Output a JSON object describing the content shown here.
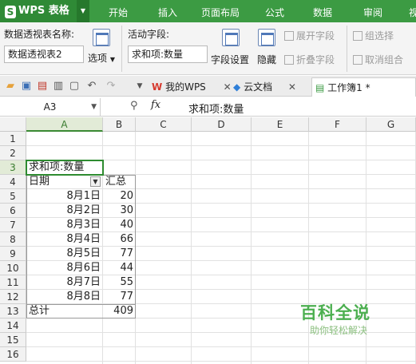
{
  "app": {
    "logo_text": "WPS 表格",
    "logo_mark": "S"
  },
  "tabs": [
    "开始",
    "插入",
    "页面布局",
    "公式",
    "数据",
    "审阅",
    "视"
  ],
  "ribbon": {
    "pivot_name_label": "数据透视表名称:",
    "pivot_name_value": "数据透视表2",
    "options_label": "选项",
    "active_field_label": "活动字段:",
    "active_field_value": "求和项:数量",
    "field_settings_label": "字段设置",
    "hide_label": "隐藏",
    "expand_field_label": "展开字段",
    "collapse_field_label": "折叠字段",
    "group_selection_label": "组选择",
    "ungroup_label": "取消组合"
  },
  "doc_tabs": [
    {
      "label": "我的WPS"
    },
    {
      "label": "云文档"
    },
    {
      "label": "工作簿1 *"
    }
  ],
  "formula_bar": {
    "name_box": "A3",
    "fx": "fx",
    "value": "求和项:数量"
  },
  "sheet": {
    "columns": [
      "A",
      "B",
      "C",
      "D",
      "E",
      "F",
      "G"
    ],
    "rows": [
      "1",
      "2",
      "3",
      "4",
      "5",
      "6",
      "7",
      "8",
      "9",
      "10",
      "11",
      "12",
      "13",
      "14",
      "15",
      "16"
    ],
    "pivot_header": "求和项:数量",
    "date_header": "日期",
    "sum_header": "汇总",
    "dates": [
      "8月1日",
      "8月2日",
      "8月3日",
      "8月4日",
      "8月5日",
      "8月6日",
      "8月7日",
      "8月8日"
    ],
    "values": [
      "20",
      "30",
      "40",
      "66",
      "77",
      "44",
      "55",
      "77"
    ],
    "total_label": "总计",
    "total_value": "409"
  },
  "watermark": {
    "title": "百科全说",
    "subtitle": "助你轻松解决"
  },
  "colors": {
    "accent": "#3c9b43",
    "selection": "#2e8b30"
  }
}
